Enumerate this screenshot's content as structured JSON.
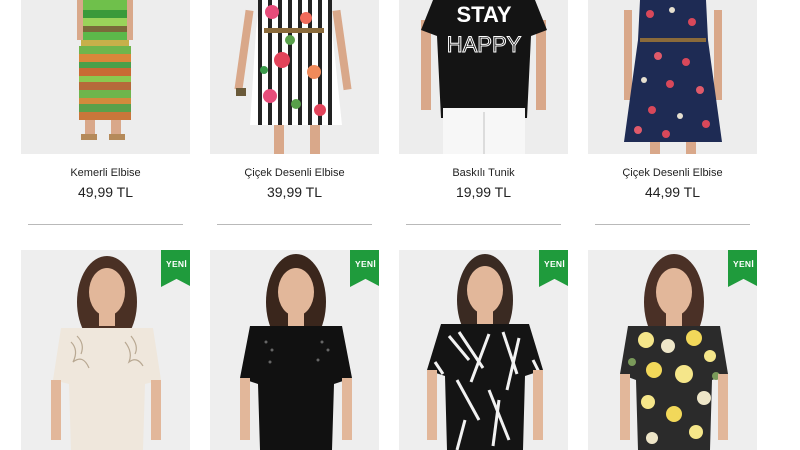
{
  "products_top": [
    {
      "name": "Kemerli Elbise",
      "price": "49,99 TL"
    },
    {
      "name": "Çiçek Desenli Elbise",
      "price": "39,99 TL"
    },
    {
      "name": "Baskılı Tunik",
      "price": "19,99 TL",
      "print_text_line1": "STAY",
      "print_text_line2": "HAPPY"
    },
    {
      "name": "Çiçek Desenli Elbise",
      "price": "44,99 TL"
    }
  ],
  "products_bottom": [
    {
      "badge": "YENİ"
    },
    {
      "badge": "YENİ"
    },
    {
      "badge": "YENİ"
    },
    {
      "badge": "YENİ"
    }
  ],
  "colors": {
    "badge": "#1f9b3c",
    "photo_background": "#ebebeb",
    "divider": "#b9b9b9"
  }
}
